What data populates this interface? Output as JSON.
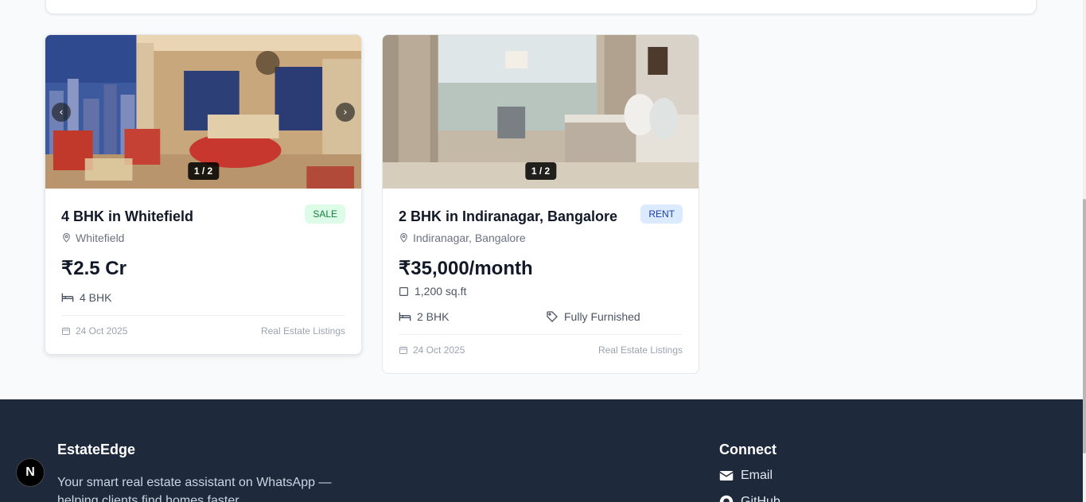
{
  "listings": [
    {
      "title": "4 BHK in Whitefield",
      "badge": "SALE",
      "location": "Whitefield",
      "price": "₹2.5 Cr",
      "bedrooms": "4 BHK",
      "date": "24 Oct 2025",
      "source": "Real Estate Listings",
      "photo_counter": "1 / 2"
    },
    {
      "title": "2 BHK in Indiranagar, Bangalore",
      "badge": "RENT",
      "location": "Indiranagar, Bangalore",
      "price": "₹35,000/month",
      "area": "1,200 sq.ft",
      "bedrooms": "2 BHK",
      "furnishing": "Fully Furnished",
      "date": "24 Oct 2025",
      "source": "Real Estate Listings",
      "photo_counter": "1 / 2"
    }
  ],
  "footer": {
    "brand": "EstateEdge",
    "tagline": "Your smart real estate assistant on WhatsApp — helping clients find homes faster.",
    "connect_heading": "Connect",
    "links": [
      {
        "label": "Email",
        "icon": "mail-icon"
      },
      {
        "label": "GitHub",
        "icon": "github-icon"
      }
    ]
  },
  "dev_badge": {
    "label": "N"
  },
  "colors": {
    "sale_badge_bg": "#dcfce7",
    "sale_badge_text": "#15803d",
    "rent_badge_bg": "#dbeafe",
    "rent_badge_text": "#1e40af",
    "footer_bg": "#1e293b"
  }
}
